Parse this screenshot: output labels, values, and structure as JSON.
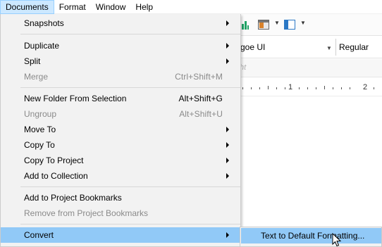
{
  "menubar": {
    "items": [
      {
        "label": "Documents",
        "active": true
      },
      {
        "label": "Format"
      },
      {
        "label": "Window"
      },
      {
        "label": "Help"
      }
    ]
  },
  "background": {
    "font_name": "goe UI",
    "font_style": "Regular",
    "style_hint": "ht",
    "ruler_numbers": [
      "1",
      "2"
    ]
  },
  "documents_menu": {
    "items": [
      {
        "label": "Snapshots",
        "shortcut": "",
        "submenu": true,
        "disabled": false
      },
      {
        "label": "Duplicate",
        "shortcut": "",
        "submenu": true,
        "disabled": false
      },
      {
        "label": "Split",
        "shortcut": "",
        "submenu": true,
        "disabled": false
      },
      {
        "label": "Merge",
        "shortcut": "Ctrl+Shift+M",
        "submenu": false,
        "disabled": true
      },
      {
        "label": "New Folder From Selection",
        "shortcut": "Alt+Shift+G",
        "submenu": false,
        "disabled": false
      },
      {
        "label": "Ungroup",
        "shortcut": "Alt+Shift+U",
        "submenu": false,
        "disabled": true
      },
      {
        "label": "Move To",
        "shortcut": "",
        "submenu": true,
        "disabled": false
      },
      {
        "label": "Copy To",
        "shortcut": "",
        "submenu": true,
        "disabled": false
      },
      {
        "label": "Copy To Project",
        "shortcut": "",
        "submenu": true,
        "disabled": false
      },
      {
        "label": "Add to Collection",
        "shortcut": "",
        "submenu": true,
        "disabled": false
      },
      {
        "label": "Add to Project Bookmarks",
        "shortcut": "",
        "submenu": false,
        "disabled": false
      },
      {
        "label": "Remove from Project Bookmarks",
        "shortcut": "",
        "submenu": false,
        "disabled": true
      },
      {
        "label": "Convert",
        "shortcut": "",
        "submenu": true,
        "disabled": false,
        "highlighted": true
      }
    ]
  },
  "convert_submenu": {
    "items": [
      {
        "label": "Text to Default Formatting...",
        "highlighted": true
      }
    ]
  },
  "colors": {
    "highlight": "#91c9f7",
    "menu_bg": "#f2f2f2",
    "active_menubar_bg": "#cce8ff",
    "disabled_text": "#8a8a8a"
  },
  "icons": [
    "chart-icon",
    "layout-icon",
    "panel-icon",
    "submenu-arrow-icon",
    "dropdown-caret-icon",
    "mouse-pointer-icon"
  ]
}
